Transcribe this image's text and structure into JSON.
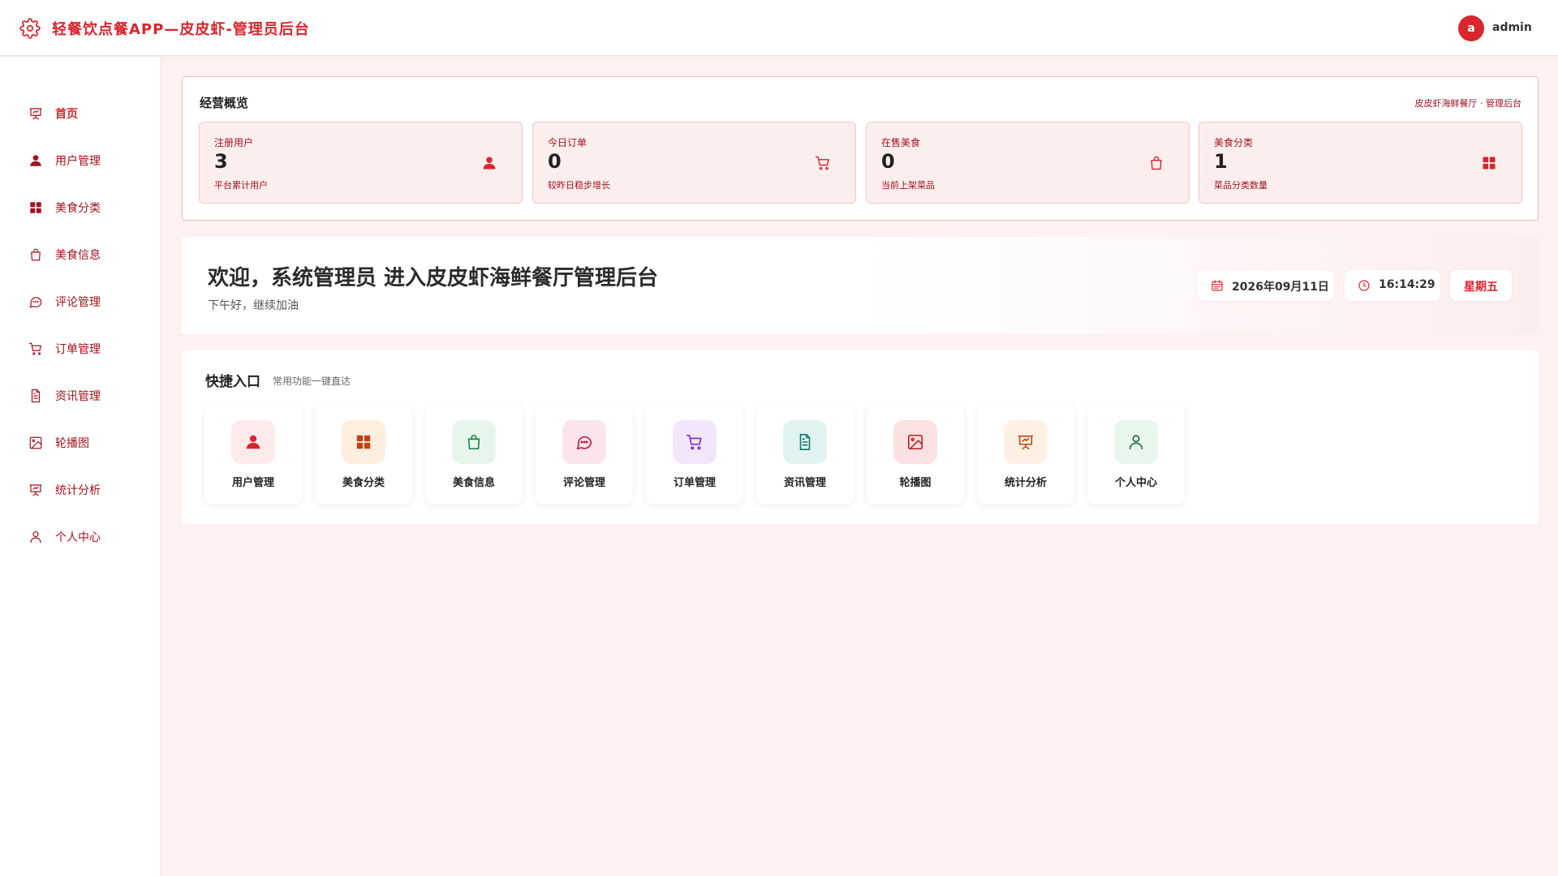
{
  "header": {
    "title": "轻餐饮点餐APP—皮皮虾-管理员后台",
    "avatar_letter": "a",
    "username": "admin",
    "icon": "gear-icon",
    "accent": "#d9252c"
  },
  "sidebar": {
    "items": [
      {
        "label": "首页",
        "icon": "presentation-chart-icon",
        "active": true
      },
      {
        "label": "用户管理",
        "icon": "user-icon"
      },
      {
        "label": "美食分类",
        "icon": "grid-icon"
      },
      {
        "label": "美食信息",
        "icon": "shopping-bag-icon"
      },
      {
        "label": "评论管理",
        "icon": "chat-bubble-icon"
      },
      {
        "label": "订单管理",
        "icon": "cart-icon"
      },
      {
        "label": "资讯管理",
        "icon": "document-icon"
      },
      {
        "label": "轮播图",
        "icon": "image-icon"
      },
      {
        "label": "统计分析",
        "icon": "presentation-chart-icon"
      },
      {
        "label": "个人中心",
        "icon": "user-outline-icon"
      }
    ]
  },
  "overview": {
    "title": "经营概览",
    "subtitle": "皮皮虾海鲜餐厅 · 管理后台",
    "stats": [
      {
        "label": "注册用户",
        "value": "3",
        "desc": "平台累计用户",
        "icon": "user-icon"
      },
      {
        "label": "今日订单",
        "value": "0",
        "desc": "较昨日稳步增长",
        "icon": "cart-icon"
      },
      {
        "label": "在售美食",
        "value": "0",
        "desc": "当前上架菜品",
        "icon": "shopping-bag-icon"
      },
      {
        "label": "美食分类",
        "value": "1",
        "desc": "菜品分类数量",
        "icon": "grid-icon"
      }
    ]
  },
  "welcome": {
    "title": "欢迎，系统管理员 进入皮皮虾海鲜餐厅管理后台",
    "subtitle": "下午好，继续加油",
    "date": "2026年09月11日",
    "time": "16:14:29",
    "weekday": "星期五"
  },
  "quick": {
    "title": "快捷入口",
    "subtitle": "常用功能一键直达",
    "items": [
      {
        "label": "用户管理",
        "icon": "user-icon",
        "bg": "#fdebec",
        "color": "#d9252c"
      },
      {
        "label": "美食分类",
        "icon": "grid-icon",
        "bg": "#fdeedf",
        "color": "#c2410c"
      },
      {
        "label": "美食信息",
        "icon": "shopping-bag-icon",
        "bg": "#e6f6ec",
        "color": "#15803d"
      },
      {
        "label": "评论管理",
        "icon": "chat-bubble-icon",
        "bg": "#fbe4ec",
        "color": "#be123c"
      },
      {
        "label": "订单管理",
        "icon": "cart-icon",
        "bg": "#f2e6fa",
        "color": "#7e22ce"
      },
      {
        "label": "资讯管理",
        "icon": "document-icon",
        "bg": "#e1f3f1",
        "color": "#0f766e"
      },
      {
        "label": "轮播图",
        "icon": "image-icon",
        "bg": "#fbe1e1",
        "color": "#b91c1c"
      },
      {
        "label": "统计分析",
        "icon": "presentation-chart-icon",
        "bg": "#fef1e3",
        "color": "#c2410c"
      },
      {
        "label": "个人中心",
        "icon": "user-outline-icon",
        "bg": "#e8f6ee",
        "color": "#166534"
      }
    ]
  }
}
